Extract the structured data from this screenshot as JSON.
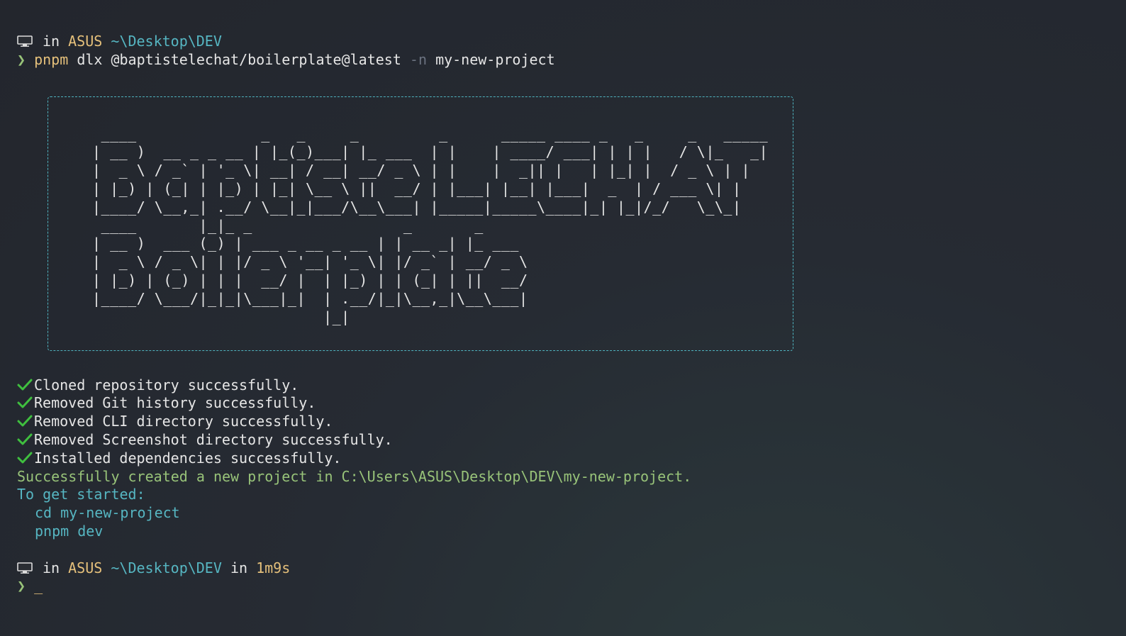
{
  "prompt1": {
    "in_word": "in",
    "host": "ASUS",
    "path": "~\\Desktop\\DEV"
  },
  "command": {
    "chevron": "❯",
    "program": "pnpm",
    "args": "dlx @baptistelechat/boilerplate@latest",
    "flag": "-n",
    "value": "my-new-project"
  },
  "banner": {
    "ascii_line_1": " ____              _   _     _         _      _____ ____ _   _     _   _____",
    "ascii_line_2": "| __ )  __ _ _ __ | |_(_)___| |_ ___  | |    | ____/ ___| | | |   / \\|_   _|",
    "ascii_line_3": "|  _ \\ / _` | '_ \\| __| / __| __/ _ \\ | |    |  _|| |   | |_| |  / _ \\ | |",
    "ascii_line_4": "| |_) | (_| | |_) | |_| \\__ \\ ||  __/ | |___| |__| |___|  _  | / ___ \\| |",
    "ascii_line_5": "|____/ \\__,_| .__/ \\__|_|___/\\__\\___| |_____|_____\\____|_| |_|/_/   \\_\\_|",
    "ascii_line_6": " ____       |_|_ _                 _       _",
    "ascii_line_7": "| __ )  ___ (_) | ___ _ __ _ __ | | __ _| |_ ___",
    "ascii_line_8": "|  _ \\ / _ \\| | |/ _ \\ '__| '_ \\| |/ _` | __/ _ \\",
    "ascii_line_9": "| |_) | (_) | | |  __/ |  | |_) | | (_| | ||  __/",
    "ascii_line_10": "|____/ \\___/|_|_|\\___|_|  | .__/|_|\\__,_|\\__\\___|",
    "ascii_line_11": "                          |_|"
  },
  "steps": [
    "Cloned repository successfully.",
    "Removed Git history successfully.",
    "Removed CLI directory successfully.",
    "Removed Screenshot directory successfully.",
    "Installed dependencies successfully."
  ],
  "result": {
    "created": "Successfully created a new project in C:\\Users\\ASUS\\Desktop\\DEV\\my-new-project.",
    "get_started": "To get started:",
    "cmd1": "cd my-new-project",
    "cmd2": "pnpm dev"
  },
  "prompt2": {
    "in_word": "in",
    "host": "ASUS",
    "path": "~\\Desktop\\DEV",
    "in_word2": "in",
    "duration": "1m9s",
    "chevron": "❯",
    "cursor": "_"
  },
  "colors": {
    "host": "#e5c07b",
    "path": "#56b6c2",
    "success": "#98c379",
    "border": "#4fb3bf",
    "check": "#3fbf3f"
  }
}
